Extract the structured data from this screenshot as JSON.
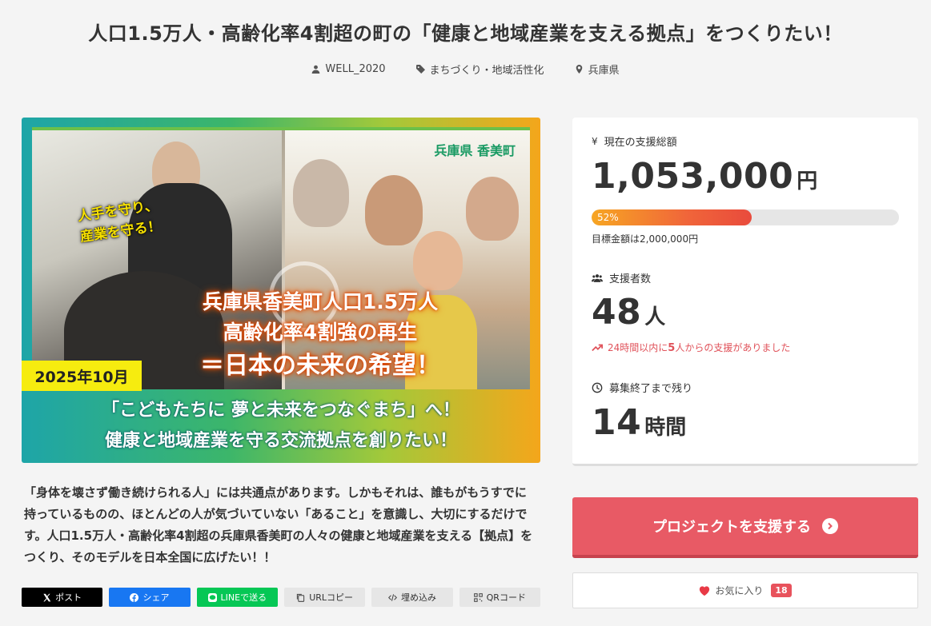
{
  "project": {
    "title": "人口1.5万人・高齢化率4割超の町の「健康と地域産業を支える拠点」をつくりたい！",
    "owner": "WELL_2020",
    "category": "まちづくり・地域活性化",
    "location": "兵庫県"
  },
  "hero": {
    "location_label": "兵庫県 香美町",
    "protect_line1": "人手を守り、",
    "protect_line2": "産業を守る！",
    "main_line1": "兵庫県香美町人口1.5万人",
    "main_line2": "高齢化率4割強の再生",
    "main_line3": "＝日本の未来の希望！",
    "date_badge": "2025年10月",
    "banner_line1": "「こどもたちに 夢と未来をつなぐまち」へ！",
    "banner_line2": "健康と地域産業を守る交流拠点を創りたい！"
  },
  "description": "「身体を壊さず働き続けられる人」には共通点があります。しかもそれは、誰もがもうすでに持っているものの、ほとんどの人が気づいていない「あること」を意識し、大切にするだけです。人口1.5万人・高齢化率4割超の兵庫県香美町の人々の健康と地域産業を支える【拠点】をつくり、そのモデルを日本全国に広げたい！！",
  "share": {
    "x_label": "ポスト",
    "facebook_label": "シェア",
    "line_label": "LINEで送る",
    "copy_url_label": "URLコピー",
    "embed_label": "埋め込み",
    "qr_label": "QRコード"
  },
  "stats": {
    "total_label": "現在の支援総額",
    "total_amount": "1,053,000",
    "total_unit": "円",
    "progress_percent": 52,
    "progress_label": "52%",
    "goal_text": "目標金額は2,000,000円",
    "supporters_label": "支援者数",
    "supporters_count": "48",
    "supporters_unit": "人",
    "recent_prefix": "24時間以内に",
    "recent_count": "5",
    "recent_suffix": "人からの支援がありました",
    "remaining_label": "募集終了まで残り",
    "remaining_value": "14",
    "remaining_unit": "時間"
  },
  "actions": {
    "support_label": "プロジェクトを支援する",
    "favorite_label": "お気に入り",
    "favorite_count": "18"
  },
  "colors": {
    "accent": "#e85a65",
    "progress_start": "#f7a623",
    "progress_end": "#e94b3c",
    "recent_text": "#e0525a"
  }
}
